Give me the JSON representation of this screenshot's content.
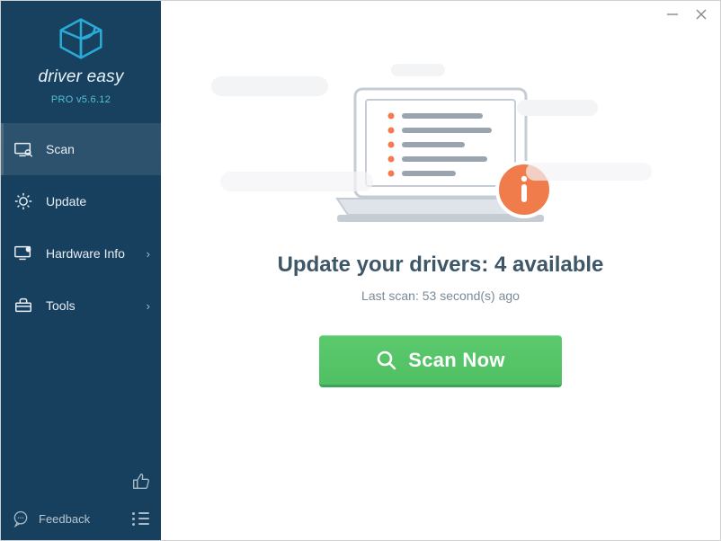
{
  "brand": {
    "name": "driver easy",
    "version_label": "PRO v5.6.12"
  },
  "sidebar": {
    "items": [
      {
        "label": "Scan",
        "active": true
      },
      {
        "label": "Update",
        "active": false
      },
      {
        "label": "Hardware Info",
        "active": false,
        "has_submenu": true
      },
      {
        "label": "Tools",
        "active": false,
        "has_submenu": true
      }
    ],
    "feedback_label": "Feedback"
  },
  "main": {
    "headline": "Update your drivers: 4 available",
    "last_scan": "Last scan: 53 second(s) ago",
    "scan_button": "Scan Now"
  },
  "icons": {
    "logo": "logo-icon",
    "scan": "magnifier-monitor-icon",
    "update": "gear-arrows-icon",
    "hardware": "monitor-info-icon",
    "tools": "toolbox-icon",
    "feedback": "speech-bubble-icon",
    "like": "thumbs-up-icon",
    "list": "list-icon",
    "minimize": "minimize-icon",
    "close": "close-icon",
    "info": "info-badge-icon",
    "scan_glass": "search-icon"
  }
}
